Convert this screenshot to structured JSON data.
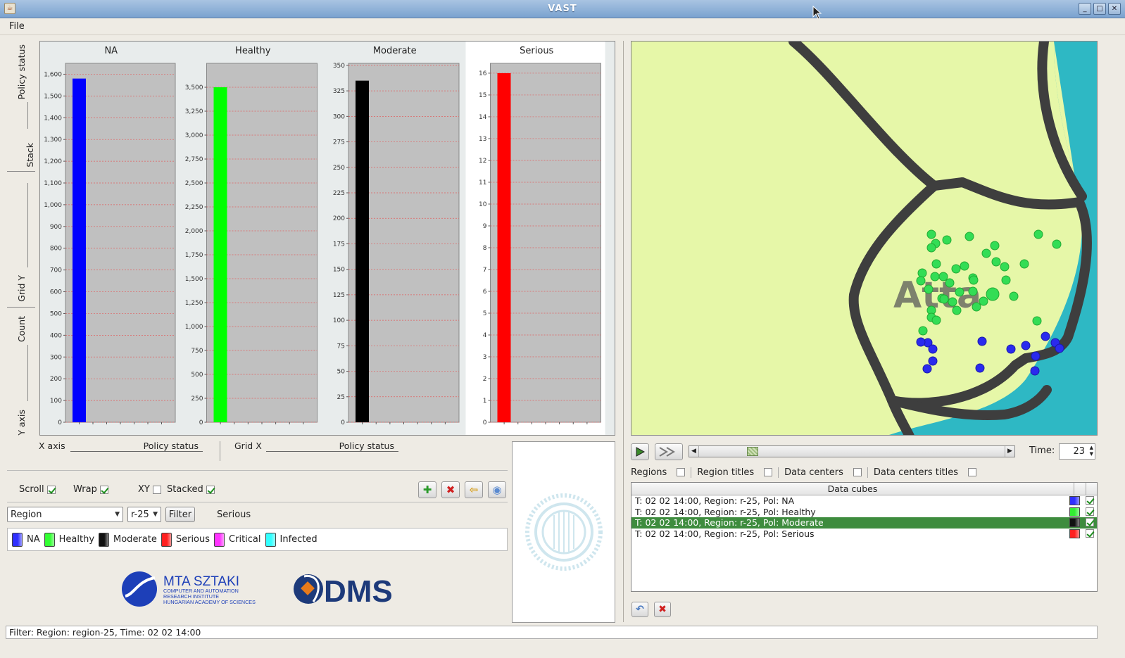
{
  "window": {
    "title": "VAST",
    "minimize": "_",
    "maximize": "□",
    "close": "✕"
  },
  "menu": {
    "file": "File"
  },
  "side_tabs": [
    "Policy status",
    "Stack",
    "Grid Y",
    "Count",
    "Y axis"
  ],
  "chart_data": {
    "type": "bar",
    "panels": [
      {
        "title": "NA",
        "color": "#0000ff",
        "value": 1580,
        "ylim": [
          0,
          1650
        ],
        "ticks": [
          0,
          100,
          200,
          300,
          400,
          500,
          600,
          700,
          800,
          900,
          1000,
          1100,
          1200,
          1300,
          1400,
          1500,
          1600
        ],
        "tick_labels": [
          "0",
          "100",
          "200",
          "300",
          "400",
          "500",
          "600",
          "700",
          "800",
          "900",
          "1,000",
          "1,100",
          "1,200",
          "1,300",
          "1,400",
          "1,500",
          "1,600"
        ]
      },
      {
        "title": "Healthy",
        "color": "#00ff00",
        "value": 3500,
        "ylim": [
          0,
          3750
        ],
        "ticks": [
          0,
          250,
          500,
          750,
          1000,
          1250,
          1500,
          1750,
          2000,
          2250,
          2500,
          2750,
          3000,
          3250,
          3500
        ],
        "tick_labels": [
          "0",
          "250",
          "500",
          "750",
          "1,000",
          "1,250",
          "1,500",
          "1,750",
          "2,000",
          "2,250",
          "2,500",
          "2,750",
          "3,000",
          "3,250",
          "3,500"
        ]
      },
      {
        "title": "Moderate",
        "color": "#000000",
        "value": 335,
        "ylim": [
          0,
          352
        ],
        "ticks": [
          0,
          25,
          50,
          75,
          100,
          125,
          150,
          175,
          200,
          225,
          250,
          275,
          300,
          325,
          350
        ],
        "tick_labels": [
          "0",
          "25",
          "50",
          "75",
          "100",
          "125",
          "150",
          "175",
          "200",
          "225",
          "250",
          "275",
          "300",
          "325",
          "350"
        ]
      },
      {
        "title": "Serious",
        "color": "#ff0000",
        "value": 16,
        "ylim": [
          0,
          16.45
        ],
        "ticks": [
          0,
          1,
          2,
          3,
          4,
          5,
          6,
          7,
          8,
          9,
          10,
          11,
          12,
          13,
          14,
          15,
          16
        ],
        "tick_labels": [
          "0",
          "1",
          "2",
          "3",
          "4",
          "5",
          "6",
          "7",
          "8",
          "9",
          "10",
          "11",
          "12",
          "13",
          "14",
          "15",
          "16"
        ]
      }
    ]
  },
  "axes": {
    "x_axis_label": "X axis",
    "x_axis_value": "Policy status",
    "grid_x_label": "Grid X",
    "grid_x_value": "Policy status"
  },
  "options": {
    "scroll": "Scroll",
    "wrap": "Wrap",
    "xy": "XY",
    "stacked": "Stacked"
  },
  "filter": {
    "field": "Region",
    "value": "r-25",
    "button": "Filter",
    "status_label": "Serious"
  },
  "legend": [
    {
      "label": "NA",
      "color": "#3030ff"
    },
    {
      "label": "Healthy",
      "color": "#33ff33"
    },
    {
      "label": "Moderate",
      "color": "#111111"
    },
    {
      "label": "Serious",
      "color": "#ff2020"
    },
    {
      "label": "Critical",
      "color": "#ff33ff"
    },
    {
      "label": "Infected",
      "color": "#33ffff"
    }
  ],
  "logos": {
    "mta_name": "MTA SZTAKI",
    "mta_line1": "COMPUTER AND AUTOMATION",
    "mta_line2": "RESEARCH INSTITUTE",
    "mta_line3": "HUNGARIAN ACADEMY OF SCIENCES",
    "dms": "DMS"
  },
  "map": {
    "region_label": "Atta"
  },
  "playback": {
    "time_label": "Time:",
    "time_value": "23",
    "position": 0.16
  },
  "layers": {
    "regions": "Regions",
    "region_titles": "Region titles",
    "data_centers": "Data centers",
    "data_centers_titles": "Data centers titles"
  },
  "data_cubes": {
    "title": "Data cubes",
    "rows": [
      {
        "text": "T: 02 02 14:00, Region: r-25, Pol: NA",
        "color": "#3030ff",
        "selected": false
      },
      {
        "text": "T: 02 02 14:00, Region: r-25, Pol: Healthy",
        "color": "#33ee33",
        "selected": false
      },
      {
        "text": "T: 02 02 14:00, Region: r-25, Pol: Moderate",
        "color": "#111111",
        "selected": true
      },
      {
        "text": "T: 02 02 14:00, Region: r-25, Pol: Serious",
        "color": "#ff2020",
        "selected": false
      }
    ]
  },
  "status": "Filter:  Region: region-25, Time: 02 02 14:00"
}
